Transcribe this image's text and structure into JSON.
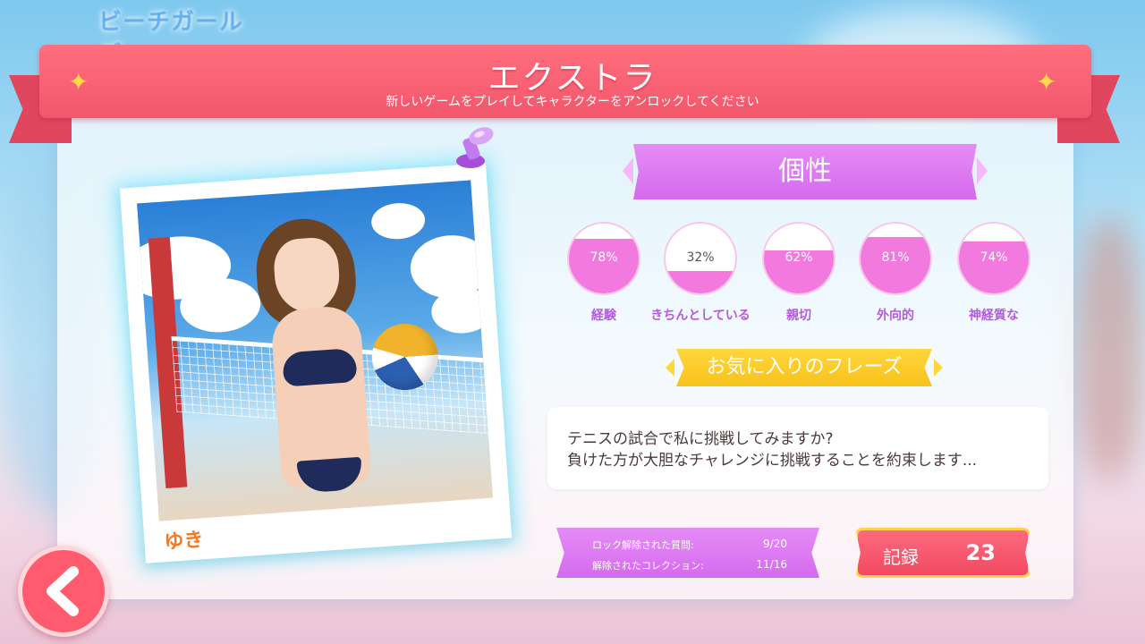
{
  "background": {
    "logo_text": "ビーチガールズ"
  },
  "header": {
    "title": "エクストラ",
    "subtitle": "新しいゲームをプレイしてキャラクターをアンロックしてください"
  },
  "character": {
    "name": "ゆき"
  },
  "personality": {
    "title": "個性",
    "stats": [
      {
        "label": "経験",
        "value": "78%",
        "percent": 78
      },
      {
        "label": "きちんとしている",
        "value": "32%",
        "percent": 32
      },
      {
        "label": "親切",
        "value": "62%",
        "percent": 62
      },
      {
        "label": "外向的",
        "value": "81%",
        "percent": 81
      },
      {
        "label": "神経質な",
        "value": "74%",
        "percent": 74
      }
    ]
  },
  "favorite_phrase": {
    "title": "お気に入りのフレーズ",
    "line1": "テニスの試合で私に挑戦してみますか?",
    "line2": "負けた方が大胆なチャレンジに挑戦することを約束します..."
  },
  "progress": {
    "unlocked_questions_label": "ロック解除された質問:",
    "unlocked_questions_value": "9/20",
    "unlocked_collections_label": "解除されたコレクション:",
    "unlocked_collections_value": "11/16"
  },
  "record": {
    "label": "記録",
    "value": "23"
  },
  "colors": {
    "ribbon": "#f2566b",
    "purple_tag": "#d56aee",
    "gauge_fill": "#f27adf",
    "yellow_tag": "#f7c21c",
    "back_button": "#ff5a6e"
  },
  "icons": [
    "sparkle-icon",
    "pushpin-icon",
    "back-arrow-icon"
  ]
}
